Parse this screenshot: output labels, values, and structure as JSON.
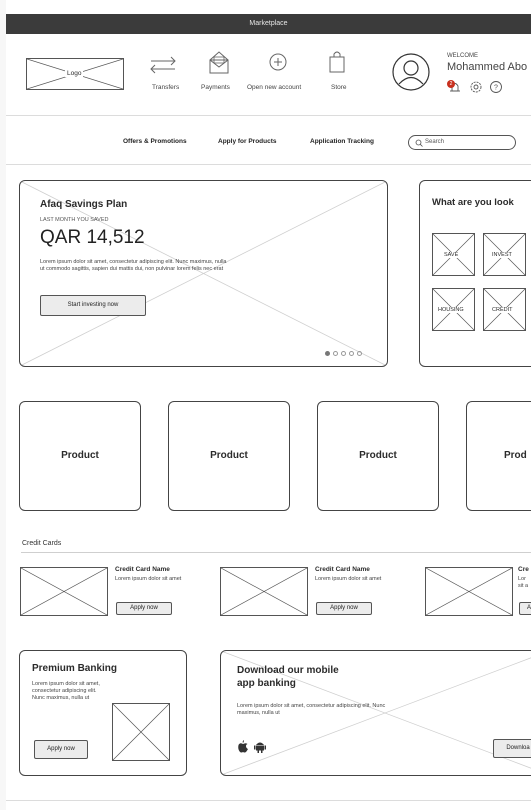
{
  "window": {
    "title": "Marketplace"
  },
  "header": {
    "logo_label": "Logo",
    "nav": [
      {
        "label": "Transfers",
        "icon": "transfer-icon"
      },
      {
        "label": "Payments",
        "icon": "payments-icon"
      },
      {
        "label": "Open new account",
        "icon": "plus-circle-icon"
      },
      {
        "label": "Store",
        "icon": "shopping-bag-icon"
      }
    ],
    "welcome_label": "WELCOME",
    "user_name": "Mohammed Abo",
    "notification_count": "2"
  },
  "menu": {
    "items": [
      "Offers & Promotions",
      "Apply for Products",
      "Application Tracking"
    ],
    "search_placeholder": "Search"
  },
  "hero": {
    "title": "Afaq Savings Plan",
    "caption": "LAST MONTH YOU SAVED",
    "amount": "QAR 14,512",
    "body": "Lorem ipsum dolor sit amet, consectetur adipiscing elit. Nunc maximus, nulla ut commodo sagittis, sapien dui mattis dui, non pulvinar lorem felis nec erat",
    "button": "Start investing now",
    "active_slide": 1,
    "slide_count": 5
  },
  "looking": {
    "title": "What are you look",
    "tiles": [
      "SAVE",
      "INVEST",
      "HOUSING",
      "CREDIT"
    ]
  },
  "products": [
    "Product",
    "Product",
    "Product",
    "Prod"
  ],
  "credit_cards": {
    "section_title": "Credit Cards",
    "items": [
      {
        "name": "Credit Card Name",
        "desc": "Lorem ipsum dolor sit amet",
        "button": "Apply now"
      },
      {
        "name": "Credit Card Name",
        "desc": "Lorem ipsum dolor sit amet",
        "button": "Apply now"
      },
      {
        "name": "Cre",
        "desc": "Lor sit a",
        "button": "A"
      }
    ]
  },
  "premium": {
    "title": "Premium Banking",
    "body": "Lorem ipsum dolor sit amet, consectetur adipiscing elit. Nunc maximus, nulla ut",
    "button": "Apply now"
  },
  "app_promo": {
    "title_line1": "Download our mobile",
    "title_line2": "app banking",
    "body": "Lorem ipsum dolor sit amet, consectetur adipiscing elit. Nunc maximus, nulla ut",
    "button": "Downloa"
  }
}
